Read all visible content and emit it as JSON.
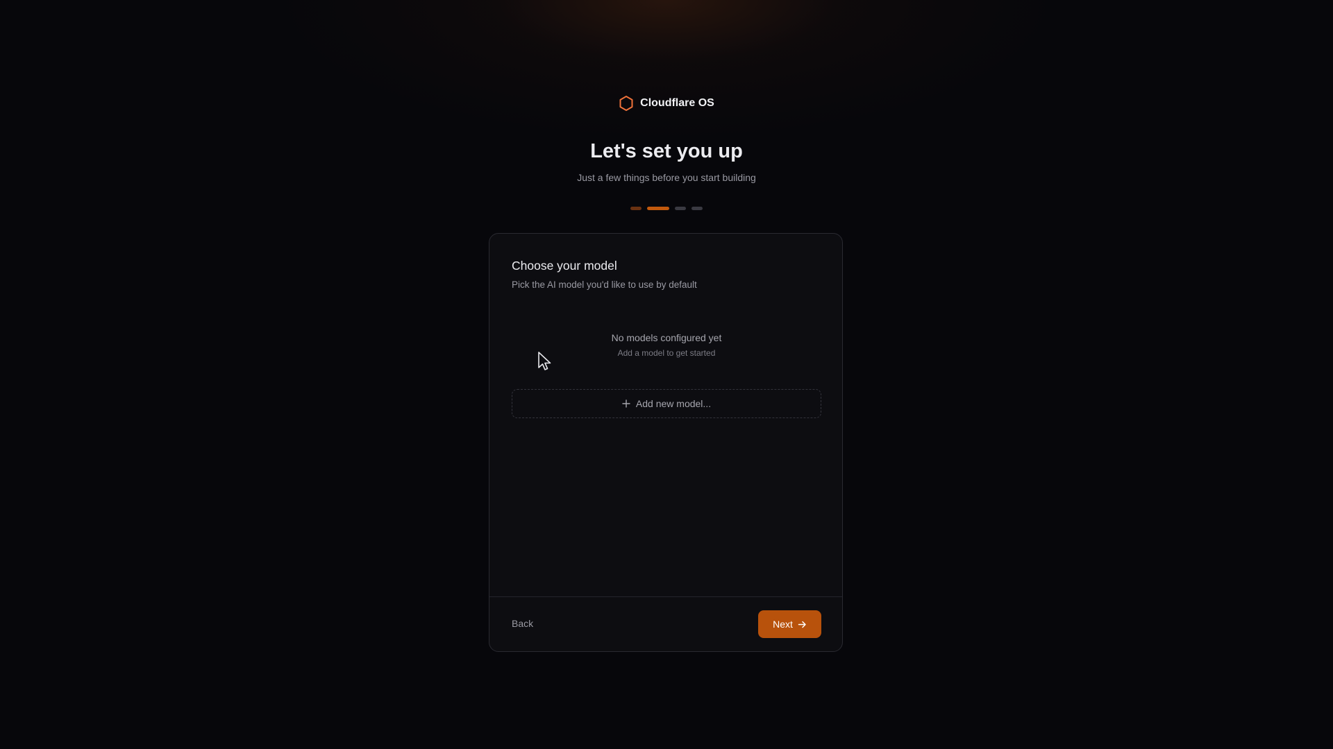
{
  "brand": {
    "name": "Cloudflare OS",
    "icon": "hexagon-icon",
    "accent": "#f0723a"
  },
  "header": {
    "title": "Let's set you up",
    "subtitle": "Just a few things before you start building"
  },
  "progress": {
    "total_steps": 4,
    "current_step": 2,
    "active_color": "#c2590d"
  },
  "card": {
    "title": "Choose your model",
    "description": "Pick the AI model you'd like to use by default",
    "empty_state": {
      "title": "No models configured yet",
      "subtitle": "Add a model to get started"
    },
    "add_model": {
      "label": "Add new model...",
      "icon": "plus-icon"
    }
  },
  "footer": {
    "back_label": "Back",
    "next_label": "Next",
    "next_icon": "arrow-right-icon",
    "next_color": "#b8520c"
  }
}
